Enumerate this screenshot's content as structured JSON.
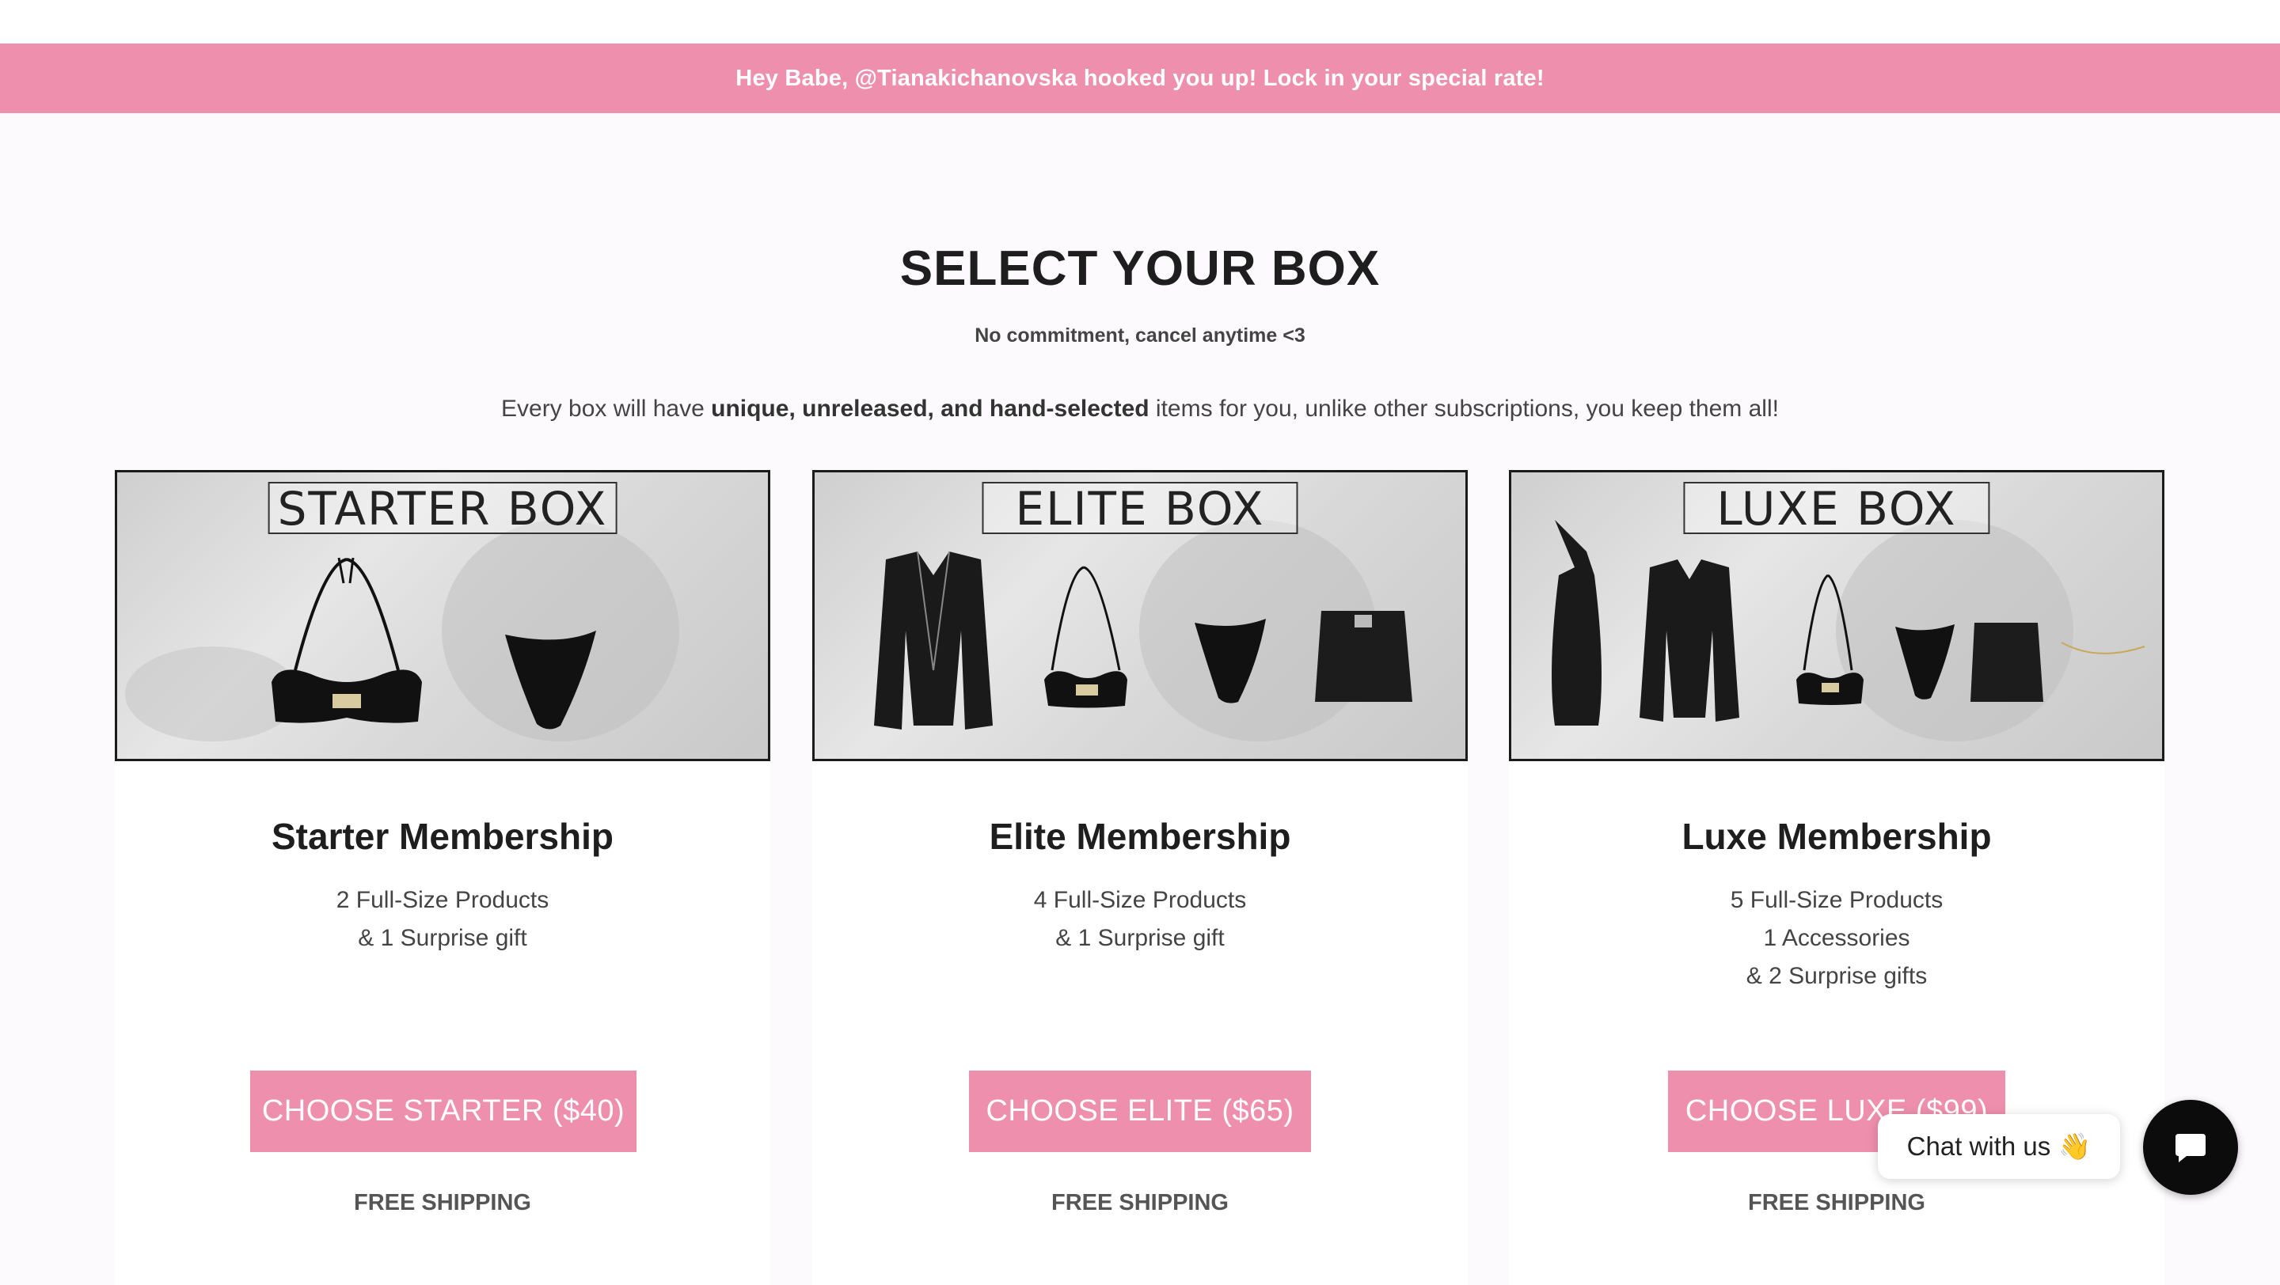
{
  "promo_banner": "Hey Babe, @Tianakichanovska hooked you up! Lock in your special rate!",
  "heading": "SELECT YOUR BOX",
  "subheading": "No commitment, cancel anytime <3",
  "description": {
    "prefix": "Every box will have ",
    "bold": "unique, unreleased, and hand-selected",
    "suffix": " items for you, unlike other subscriptions, you keep them all!"
  },
  "plans": [
    {
      "box_label": "STARTER BOX",
      "name": "Starter Membership",
      "lines": [
        "2 Full-Size Products",
        "& 1 Surprise gift"
      ],
      "button": "CHOOSE STARTER ($40)",
      "shipping": "FREE SHIPPING"
    },
    {
      "box_label": "ELITE BOX",
      "name": "Elite Membership",
      "lines": [
        "4 Full-Size Products",
        "& 1 Surprise gift"
      ],
      "button": "CHOOSE ELITE ($65)",
      "shipping": "FREE SHIPPING"
    },
    {
      "box_label": "LUXE BOX",
      "name": "Luxe Membership",
      "lines": [
        "5 Full-Size Products",
        "1 Accessories",
        "& 2 Surprise gifts"
      ],
      "button": "CHOOSE LUXE ($99)",
      "shipping": "FREE SHIPPING"
    }
  ],
  "chat": {
    "label": "Chat with us",
    "emoji": "👋",
    "launcher_icon": "chat-bubble-icon"
  },
  "colors": {
    "brand_pink": "#ef8fae",
    "text_dark": "#1e1e1e",
    "background": "#fcfafc"
  }
}
